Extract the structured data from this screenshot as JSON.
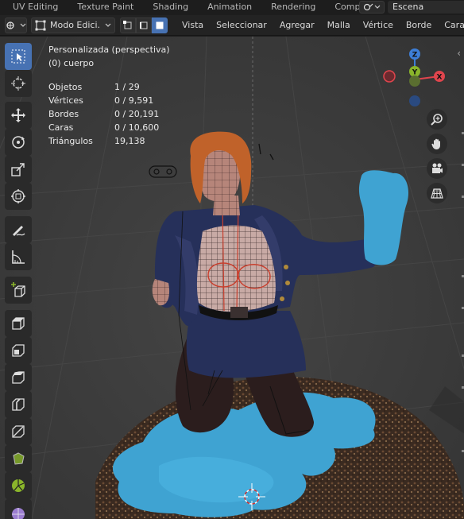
{
  "workspace_tabs": [
    "UV Editing",
    "Texture Paint",
    "Shading",
    "Animation",
    "Rendering",
    "Compositi"
  ],
  "scene": {
    "label": "Escena"
  },
  "header": {
    "mode_label": "Modo Edici...",
    "menus": [
      "Vista",
      "Seleccionar",
      "Agregar",
      "Malla",
      "Vértice",
      "Borde",
      "Cara"
    ]
  },
  "overlay": {
    "view_name": "Personalizada (perspectiva)",
    "object_name": "(0) cuerpo",
    "stats": [
      {
        "key": "Objetos",
        "value": "1 / 29"
      },
      {
        "key": "Vértices",
        "value": "0 / 9,591"
      },
      {
        "key": "Bordes",
        "value": "0 / 20,191"
      },
      {
        "key": "Caras",
        "value": "0 / 10,600"
      },
      {
        "key": "Triángulos",
        "value": "19,138"
      }
    ]
  },
  "gizmo": {
    "x": "X",
    "y": "Y",
    "z": "Z"
  },
  "colors": {
    "accent": "#4772b3",
    "axis_x": "#e0454d",
    "axis_y": "#8ab52b",
    "axis_z": "#3d7ed6",
    "water": "#3fa3d2",
    "jacket": "#26305a",
    "hair": "#c0622a",
    "skin": "#b98a7c"
  }
}
